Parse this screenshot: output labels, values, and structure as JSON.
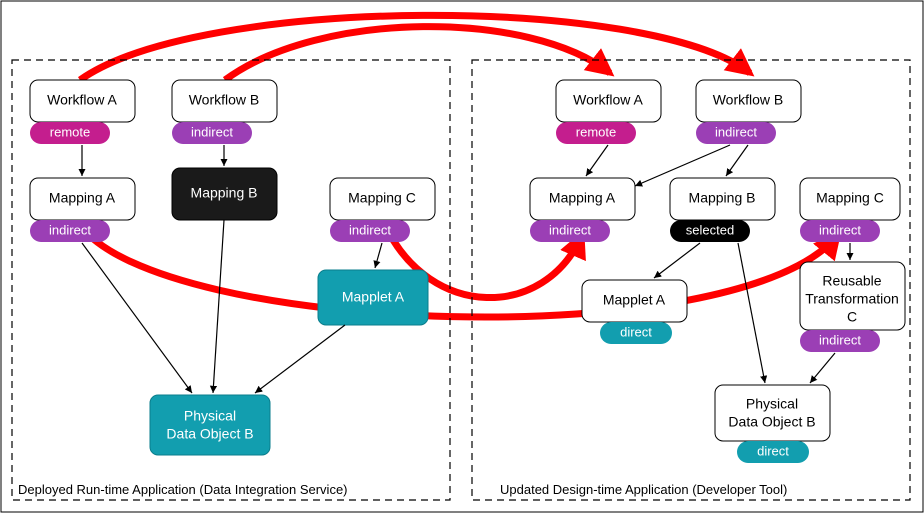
{
  "diagram_type": "dependency-comparison",
  "panels": {
    "left": {
      "caption": "Deployed Run-time Application (Data Integration Service)"
    },
    "right": {
      "caption": "Updated Design-time Application (Developer Tool)"
    }
  },
  "left": {
    "workflow_a": {
      "label": "Workflow A",
      "badge": "remote"
    },
    "workflow_b": {
      "label": "Workflow B",
      "badge": "indirect"
    },
    "mapping_a": {
      "label": "Mapping A",
      "badge": "indirect"
    },
    "mapping_b": {
      "label": "Mapping B"
    },
    "mapping_c": {
      "label": "Mapping C",
      "badge": "indirect"
    },
    "mapplet_a": {
      "label": "Mapplet A"
    },
    "pdo_b": {
      "label1": "Physical",
      "label2": "Data Object B"
    }
  },
  "right": {
    "workflow_a": {
      "label": "Workflow A",
      "badge": "remote"
    },
    "workflow_b": {
      "label": "Workflow B",
      "badge": "indirect"
    },
    "mapping_a": {
      "label": "Mapping A",
      "badge": "indirect"
    },
    "mapping_b": {
      "label": "Mapping B",
      "badge": "selected"
    },
    "mapping_c": {
      "label": "Mapping C",
      "badge": "indirect"
    },
    "mapplet_a": {
      "label": "Mapplet A",
      "badge": "direct"
    },
    "rtc": {
      "label1": "Reusable",
      "label2": "Transformation",
      "label3": "C",
      "badge": "indirect"
    },
    "pdo_b": {
      "label1": "Physical",
      "label2": "Data Object B",
      "badge": "direct"
    }
  },
  "chart_data": {
    "type": "graph-comparison",
    "left_graph": {
      "nodes": [
        {
          "id": "WA",
          "label": "Workflow A",
          "tag": "remote"
        },
        {
          "id": "WB",
          "label": "Workflow B",
          "tag": "indirect"
        },
        {
          "id": "MA",
          "label": "Mapping A",
          "tag": "indirect"
        },
        {
          "id": "MB",
          "label": "Mapping B"
        },
        {
          "id": "MC",
          "label": "Mapping C",
          "tag": "indirect"
        },
        {
          "id": "MPA",
          "label": "Mapplet A"
        },
        {
          "id": "PDOB",
          "label": "Physical Data Object B"
        }
      ],
      "edges": [
        [
          "WA",
          "MA"
        ],
        [
          "WB",
          "MB"
        ],
        [
          "MA",
          "PDOB"
        ],
        [
          "MB",
          "PDOB"
        ],
        [
          "MC",
          "MPA"
        ],
        [
          "MPA",
          "PDOB"
        ]
      ]
    },
    "right_graph": {
      "nodes": [
        {
          "id": "WA",
          "label": "Workflow A",
          "tag": "remote"
        },
        {
          "id": "WB",
          "label": "Workflow B",
          "tag": "indirect"
        },
        {
          "id": "MA",
          "label": "Mapping A",
          "tag": "indirect"
        },
        {
          "id": "MB",
          "label": "Mapping B",
          "tag": "selected"
        },
        {
          "id": "MC",
          "label": "Mapping C",
          "tag": "indirect"
        },
        {
          "id": "MPA",
          "label": "Mapplet A",
          "tag": "direct"
        },
        {
          "id": "RTC",
          "label": "Reusable Transformation C",
          "tag": "indirect"
        },
        {
          "id": "PDOB",
          "label": "Physical Data Object B",
          "tag": "direct"
        }
      ],
      "edges": [
        [
          "WA",
          "MA"
        ],
        [
          "WB",
          "MA"
        ],
        [
          "WB",
          "MB"
        ],
        [
          "MB",
          "MPA"
        ],
        [
          "MB",
          "PDOB"
        ],
        [
          "MC",
          "RTC"
        ],
        [
          "RTC",
          "PDOB"
        ]
      ]
    },
    "cross_edges_left_to_right": [
      [
        "MA",
        "MC"
      ],
      [
        "MC",
        "MA"
      ],
      [
        "WA",
        "WB"
      ],
      [
        "WB",
        "WA"
      ]
    ]
  }
}
